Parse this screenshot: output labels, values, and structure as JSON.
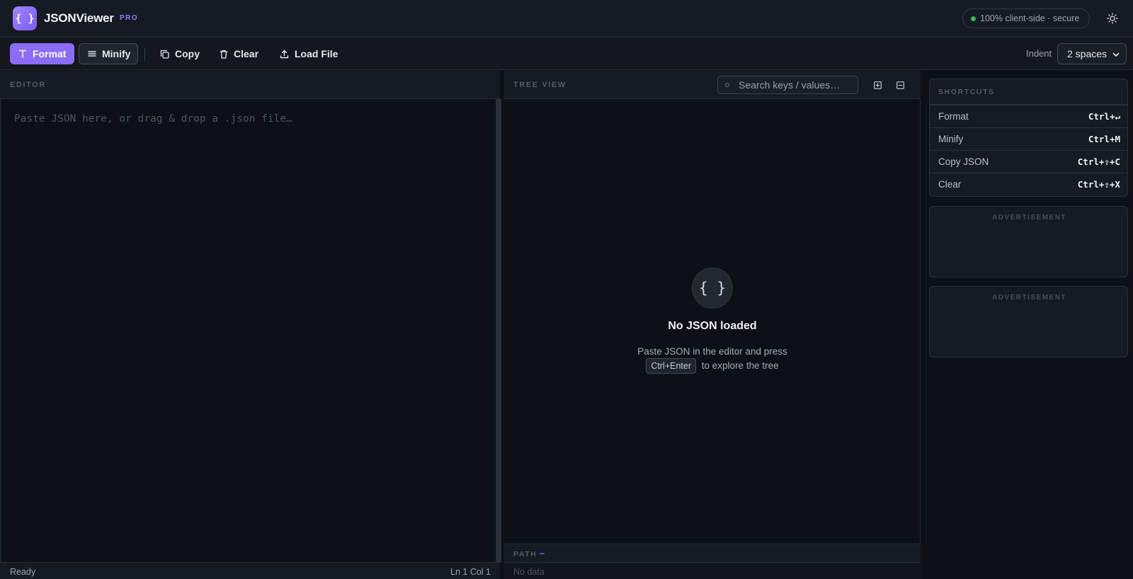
{
  "header": {
    "logo_glyph": "{ }",
    "app_name": "JSONViewer",
    "badge": "PRO",
    "secure_text": "100% client-side · secure",
    "theme_icon": "sun-icon",
    "accent_color": "#8b6cf6"
  },
  "toolbar": {
    "format_label": "Format",
    "minify_label": "Minify",
    "copy_label": "Copy",
    "clear_label": "Clear",
    "load_label": "Load File",
    "indent_label": "Indent",
    "indent_value": "2 spaces"
  },
  "editor": {
    "section_label": "EDITOR",
    "placeholder": "Paste JSON here, or drag & drop a .json file…",
    "status": "Ready",
    "position": "Ln 1 Col 1"
  },
  "tree": {
    "section_label": "TREE VIEW",
    "search_placeholder": "Search keys / values…",
    "empty_icon": "{ }",
    "empty_title": "No JSON loaded",
    "empty_desc_line1": "Paste JSON in the editor and press",
    "empty_kbd": "Ctrl+Enter",
    "empty_desc_line2": "to explore the tree",
    "path_label": "PATH",
    "path_value": "–",
    "status": "No data"
  },
  "sidebar": {
    "shortcuts_label": "SHORTCUTS",
    "shortcuts": [
      {
        "name": "Format",
        "keys": "Ctrl+↵"
      },
      {
        "name": "Minify",
        "keys": "Ctrl+M"
      },
      {
        "name": "Copy JSON",
        "keys": "Ctrl+⇧+C"
      },
      {
        "name": "Clear",
        "keys": "Ctrl+⇧+X"
      }
    ],
    "ad_label_1": "ADVERTISEMENT",
    "ad_label_2": "ADVERTISEMENT"
  }
}
